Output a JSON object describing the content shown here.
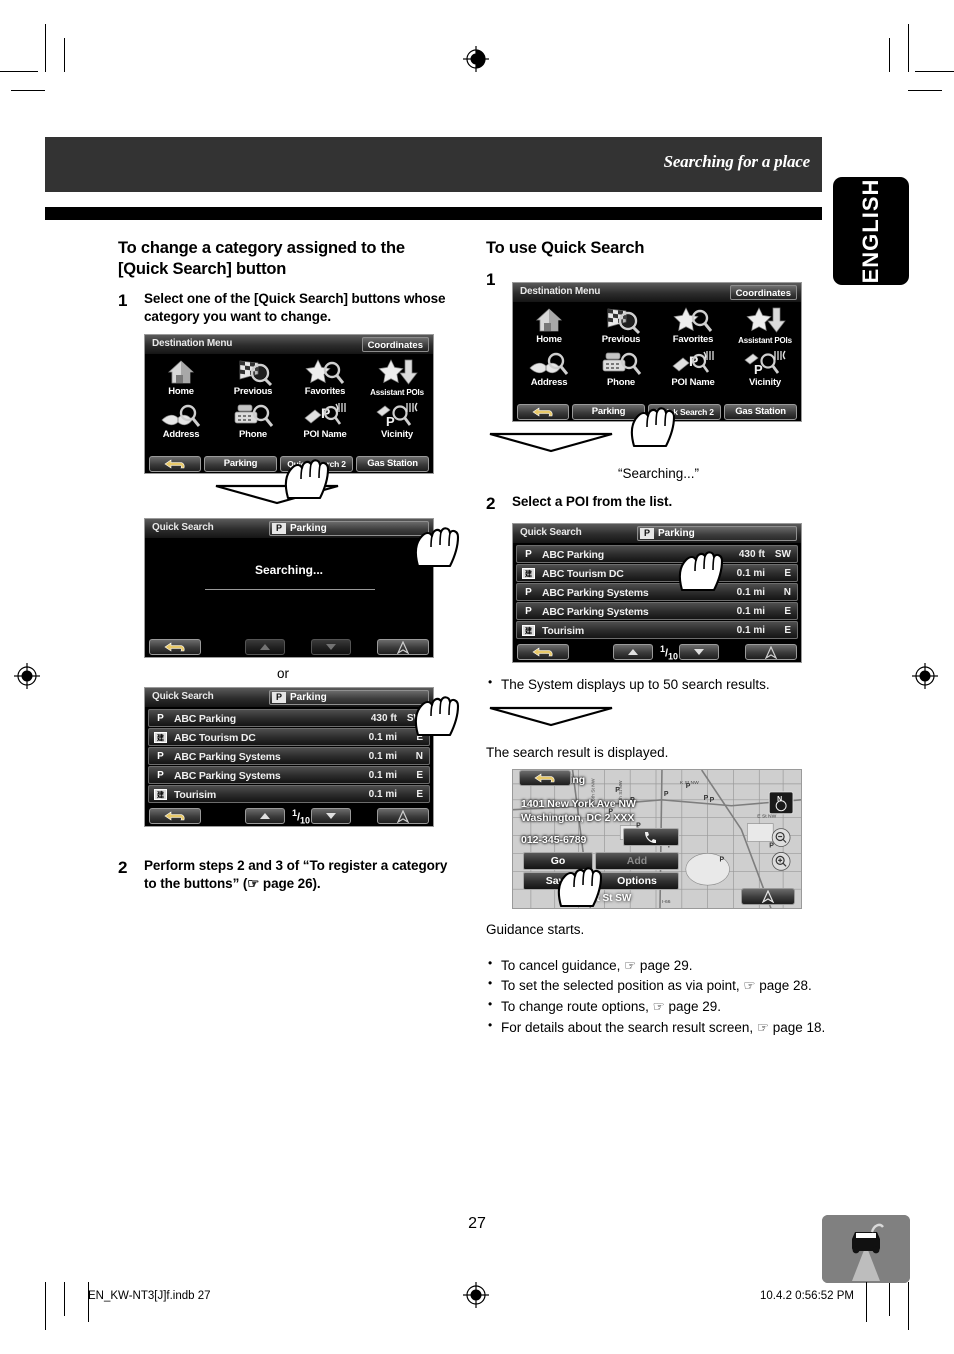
{
  "header": {
    "title": "Searching for a place",
    "language_tab": "ENGLISH"
  },
  "left_column": {
    "heading": "To change a category assigned to the [Quick Search] button",
    "steps": [
      {
        "num": "1",
        "text": "Select one of the [Quick Search] buttons whose category you want to change."
      },
      {
        "num": "2",
        "text": "Perform steps 2 and 3 of “To register a category to the buttons” (☞ page 26)."
      }
    ],
    "or_label": "or"
  },
  "right_column": {
    "heading": "To use Quick Search",
    "steps": [
      {
        "num": "1",
        "text": ""
      },
      {
        "num": "2",
        "text": "Select a POI from the list."
      }
    ],
    "searching_caption": "“Searching...”",
    "note_results": "The System displays up to 50 search results.",
    "result_displayed": "The search result is displayed.",
    "guidance_starts": "Guidance starts.",
    "bullets": [
      "To cancel guidance, ☞ page 29.",
      "To set the selected position as via point, ☞ page 28.",
      "To change route options, ☞ page 29.",
      "For details about the search result screen, ☞ page 18."
    ]
  },
  "destination_menu": {
    "title": "Destination Menu",
    "corner_button": "Coordinates",
    "icons": [
      {
        "label": "Home",
        "icon": "home-icon"
      },
      {
        "label": "Previous",
        "icon": "checkered-flag-icon"
      },
      {
        "label": "Favorites",
        "icon": "star-icon"
      },
      {
        "label": "Assistant POIs",
        "icon": "star-download-icon"
      },
      {
        "label": "Address",
        "icon": "book-magnifier-icon"
      },
      {
        "label": "Phone",
        "icon": "phone-magnifier-icon"
      },
      {
        "label": "POI Name",
        "icon": "poi-name-icon"
      },
      {
        "label": "Vicinity",
        "icon": "vicinity-icon"
      }
    ],
    "bottom_buttons": [
      {
        "label": "",
        "icon": "back-arrow-icon"
      },
      {
        "label": "Parking"
      },
      {
        "label": "Quick Search 2"
      },
      {
        "label": "Gas Station"
      }
    ]
  },
  "quick_search_searching": {
    "title": "Quick Search",
    "category_badge": "P",
    "category_name": "Parking",
    "status_text": "Searching..."
  },
  "quick_search_list": {
    "title": "Quick Search",
    "category_badge": "P",
    "category_name": "Parking",
    "columns": [
      "icon",
      "name",
      "distance",
      "direction"
    ],
    "rows": [
      {
        "icon": "P",
        "icon_type": "letter",
        "name": "ABC Parking",
        "distance": "430 ft",
        "direction": "SW"
      },
      {
        "icon": "建",
        "icon_type": "box",
        "name": "ABC Tourism DC",
        "distance": "0.1 mi",
        "direction": "E"
      },
      {
        "icon": "P",
        "icon_type": "letter",
        "name": "ABC Parking Systems",
        "distance": "0.1 mi",
        "direction": "N"
      },
      {
        "icon": "P",
        "icon_type": "letter",
        "name": "ABC Parking Systems",
        "distance": "0.1 mi",
        "direction": "E"
      },
      {
        "icon": "建",
        "icon_type": "box",
        "name": "Tourisim",
        "distance": "0.1 mi",
        "direction": "E"
      }
    ],
    "page_current": "1",
    "page_total": "10"
  },
  "map_result": {
    "poi_name": "ABC Parking",
    "address_line1": "1401 New York Ave NW",
    "address_line2": "Washington, DC 2 XXX",
    "phone": "012-345-6789",
    "buttons": [
      {
        "label": "Go"
      },
      {
        "label": "Add"
      },
      {
        "label": "Save"
      },
      {
        "label": "Options"
      }
    ],
    "street_label": "ft St SW",
    "compass_label": "N"
  },
  "footer": {
    "page_number": "27",
    "file_name": "EN_KW-NT3[J]f.indb   27",
    "timestamp": "10.4.2   0:56:52 PM"
  },
  "colors": {
    "header_bg": "#333333",
    "rule_bg": "#000000",
    "tab_bg": "#000000",
    "screen_bg": "#000000",
    "badge_bg": "#808080"
  }
}
